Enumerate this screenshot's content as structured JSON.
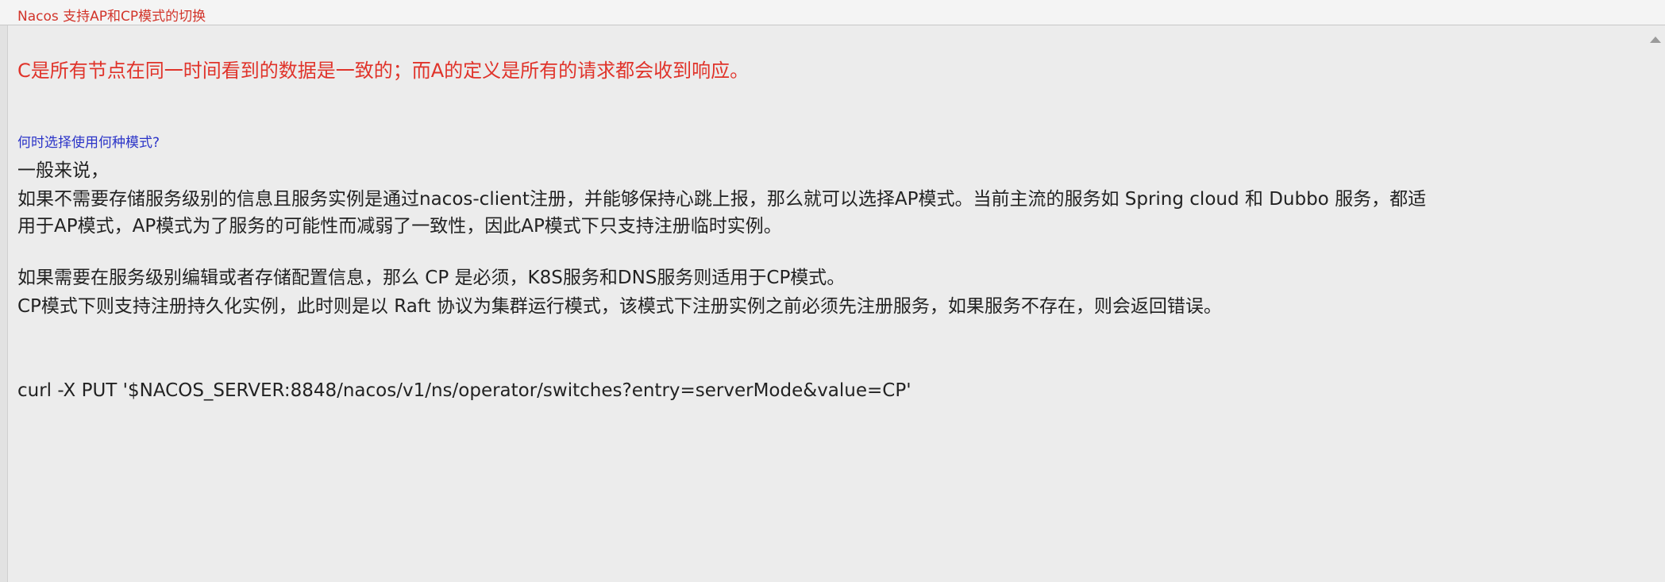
{
  "window": {
    "title": "Nacos 支持AP和CP模式的切换"
  },
  "content": {
    "cap_definition": "C是所有节点在同一时间看到的数据是一致的；而A的定义是所有的请求都会收到响应。",
    "question_heading": "何时选择使用何种模式?",
    "intro": "一般来说，",
    "ap_line_1": "如果不需要存储服务级别的信息且服务实例是通过nacos-client注册，并能够保持心跳上报，那么就可以选择AP模式。当前主流的服务如 Spring cloud 和 Dubbo 服务，都适",
    "ap_line_2": "用于AP模式，AP模式为了服务的可能性而减弱了一致性，因此AP模式下只支持注册临时实例。",
    "cp_line_1": "如果需要在服务级别编辑或者存储配置信息，那么 CP 是必须，K8S服务和DNS服务则适用于CP模式。",
    "cp_line_2": "CP模式下则支持注册持久化实例，此时则是以 Raft 协议为集群运行模式，该模式下注册实例之前必须先注册服务，如果服务不存在，则会返回错误。",
    "curl_command": "curl -X PUT '$NACOS_SERVER:8848/nacos/v1/ns/operator/switches?entry=serverMode&value=CP'"
  },
  "icons": {
    "scroll_up": "chevron-up-icon"
  }
}
